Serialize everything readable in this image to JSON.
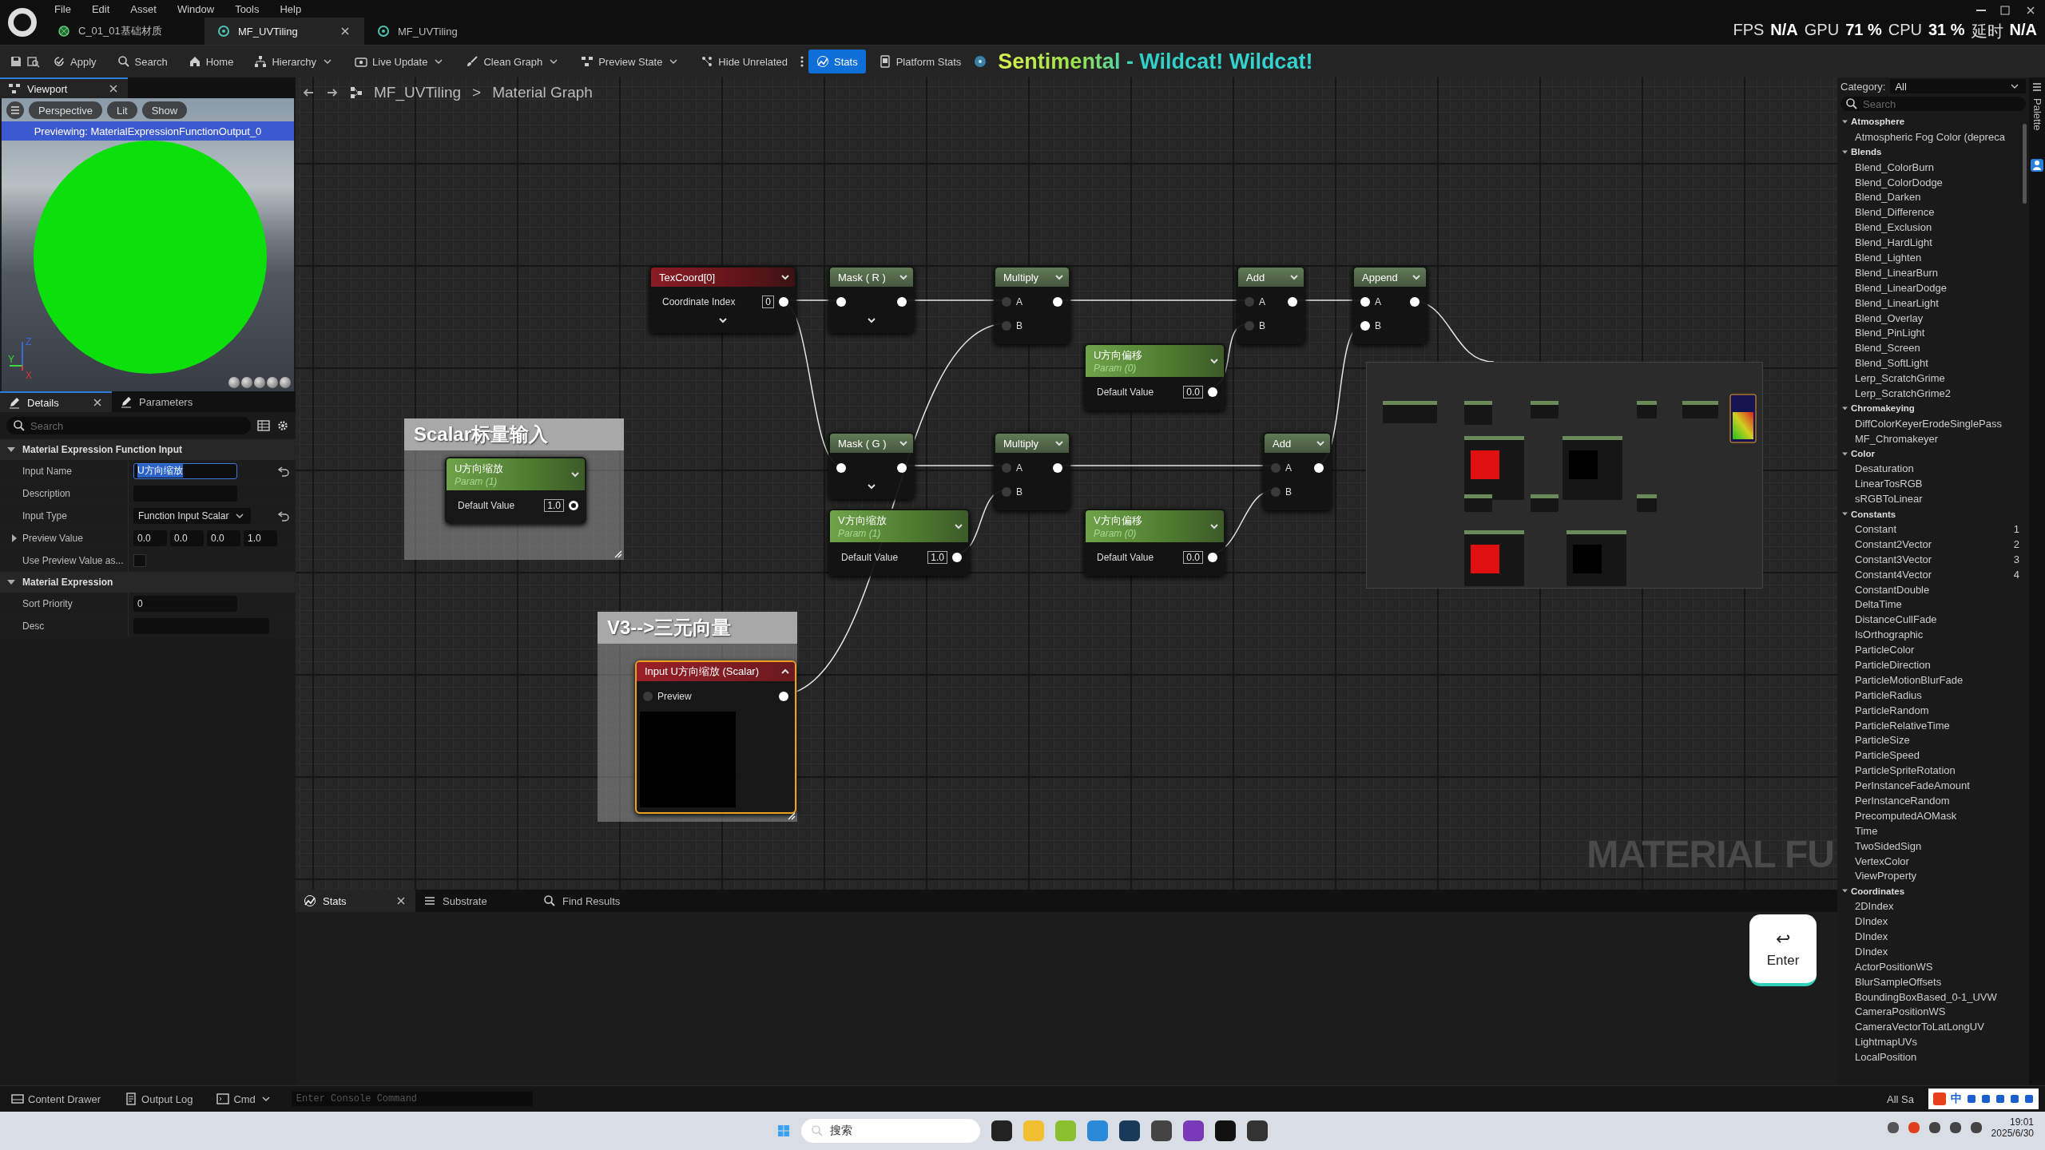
{
  "menu": [
    "File",
    "Edit",
    "Asset",
    "Window",
    "Tools",
    "Help"
  ],
  "document_tabs": [
    {
      "label": "C_01_01基础材质",
      "kind": "material",
      "selected": false,
      "closable": false
    },
    {
      "label": "MF_UVTiling",
      "kind": "function",
      "selected": true,
      "closable": true
    },
    {
      "label": "MF_UVTiling",
      "kind": "function",
      "selected": false,
      "closable": false
    }
  ],
  "perf_stats": [
    {
      "label": "FPS",
      "value": "N/A"
    },
    {
      "label": "GPU",
      "value": "71 %"
    },
    {
      "label": "CPU",
      "value": "31 %"
    },
    {
      "label": "延时",
      "value": "N/A"
    }
  ],
  "toolbar": [
    {
      "label": "Apply",
      "dropdown": false,
      "selected": false
    },
    {
      "label": "Search",
      "dropdown": false,
      "selected": false
    },
    {
      "label": "Home",
      "dropdown": false,
      "selected": false
    },
    {
      "label": "Hierarchy",
      "dropdown": true,
      "selected": false
    },
    {
      "label": "Live Update",
      "dropdown": true,
      "selected": false
    },
    {
      "label": "Clean Graph",
      "dropdown": true,
      "selected": false
    },
    {
      "label": "Preview State",
      "dropdown": true,
      "selected": false
    },
    {
      "label": "Hide Unrelated",
      "dropdown": false,
      "selected": false
    },
    {
      "label": "Stats",
      "dropdown": false,
      "selected": true
    },
    {
      "label": "Platform Stats",
      "dropdown": false,
      "selected": false
    }
  ],
  "now_playing": "Sentimental - Wildcat! Wildcat!",
  "viewport": {
    "tab": "Viewport",
    "buttons": [
      "Perspective",
      "Lit",
      "Show"
    ],
    "banner": "Previewing: MaterialExpressionFunctionOutput_0",
    "axes": [
      "Z",
      "Y",
      "X"
    ]
  },
  "details": {
    "tabs": [
      {
        "label": "Details",
        "selected": true
      },
      {
        "label": "Parameters",
        "selected": false
      }
    ],
    "search_placeholder": "Search",
    "sections": [
      {
        "title": "Material Expression Function Input",
        "expanded": true,
        "rows": [
          {
            "label": "Input Name",
            "kind": "text",
            "value": "U方向缩放",
            "text_selected": true,
            "reset": true
          },
          {
            "label": "Description",
            "kind": "text",
            "text_selected": false,
            "reset": false
          },
          {
            "label": "Input Type",
            "kind": "dropdown",
            "value": "Function Input Scalar",
            "reset": true
          },
          {
            "label": "Preview Value",
            "kind": "vector",
            "values": [
              "0.0",
              "0.0",
              "0.0",
              "1.0"
            ],
            "expanded": false,
            "reset": false
          },
          {
            "label": "Use Preview Value as...",
            "kind": "checkbox",
            "checked": false,
            "reset": false
          }
        ]
      },
      {
        "title": "Material Expression",
        "expanded": true,
        "rows": [
          {
            "label": "Sort Priority",
            "kind": "text",
            "value": "0",
            "text_selected": false,
            "reset": false
          },
          {
            "label": "Desc",
            "kind": "wide",
            "reset": false
          }
        ]
      }
    ]
  },
  "breadcrumb": [
    "MF_UVTiling",
    "Material Graph"
  ],
  "breadcrumb_separator": ">",
  "graph": {
    "nodes": [
      {
        "kind": "function",
        "title": "TexCoord[0]",
        "selected": false,
        "chevron": true,
        "rows": [
          {
            "label": "Coordinate Index",
            "value": "0",
            "out_pin": {
              "filled": true
            }
          }
        ]
      },
      {
        "kind": "math",
        "title": "Mask ( R )",
        "selected": false,
        "chevron": true,
        "rows": [
          {
            "in_pin": {
              "filled": true
            },
            "out_pin": {
              "filled": true
            }
          }
        ]
      },
      {
        "kind": "math",
        "title": "Multiply",
        "selected": false,
        "chevron": false,
        "rows": [
          {
            "label": "A",
            "in_pin": {
              "filled": false
            },
            "out_pin": {
              "filled": true
            }
          },
          {
            "label": "B",
            "in_pin": {
              "filled": false
            }
          }
        ]
      },
      {
        "kind": "math",
        "title": "Add",
        "selected": false,
        "chevron": false,
        "rows": [
          {
            "label": "A",
            "in_pin": {
              "filled": false
            },
            "out_pin": {
              "filled": true
            }
          },
          {
            "label": "B",
            "in_pin": {
              "filled": false
            }
          }
        ]
      },
      {
        "kind": "math",
        "title": "Append",
        "selected": false,
        "chevron": false,
        "rows": [
          {
            "label": "A",
            "in_pin": {
              "filled": true
            },
            "out_pin": {
              "filled": true
            }
          },
          {
            "label": "B",
            "in_pin": {
              "filled": true
            }
          }
        ]
      },
      {
        "kind": "param",
        "title": "U方向偏移",
        "subtitle": "Param (0)",
        "selected": false,
        "chevron": false,
        "rows": [
          {
            "label": "Default Value",
            "value": "0.0",
            "out_pin": {
              "filled": true
            }
          }
        ]
      },
      {
        "kind": "math",
        "title": "Mask ( G )",
        "selected": false,
        "chevron": true,
        "rows": [
          {
            "in_pin": {
              "filled": true
            },
            "out_pin": {
              "filled": true
            }
          }
        ]
      },
      {
        "kind": "math",
        "title": "Multiply",
        "selected": false,
        "chevron": false,
        "rows": [
          {
            "label": "A",
            "in_pin": {
              "filled": false
            },
            "out_pin": {
              "filled": true
            }
          },
          {
            "label": "B",
            "in_pin": {
              "filled": false
            }
          }
        ]
      },
      {
        "kind": "math",
        "title": "Add",
        "selected": false,
        "chevron": false,
        "rows": [
          {
            "label": "A",
            "in_pin": {
              "filled": false
            },
            "out_pin": {
              "filled": true
            }
          },
          {
            "label": "B",
            "in_pin": {
              "filled": false
            }
          }
        ]
      },
      {
        "kind": "param",
        "title": "V方向缩放",
        "subtitle": "Param (1)",
        "selected": false,
        "chevron": false,
        "rows": [
          {
            "label": "Default Value",
            "value": "1.0",
            "out_pin": {
              "filled": true
            }
          }
        ]
      },
      {
        "kind": "param",
        "title": "V方向偏移",
        "subtitle": "Param (0)",
        "selected": false,
        "chevron": false,
        "rows": [
          {
            "label": "Default Value",
            "value": "0.0",
            "out_pin": {
              "filled": true
            }
          }
        ]
      }
    ],
    "comments": [
      {
        "title": "Scalar标量输入",
        "nodes": [
          {
            "kind": "param",
            "title": "U方向缩放",
            "subtitle": "Param (1)",
            "selected": false,
            "chevron": false,
            "rows": [
              {
                "label": "Default Value",
                "value": "1.0",
                "out_pin": {
                  "filled": false
                }
              }
            ]
          }
        ]
      },
      {
        "title": "V3-->三元向量",
        "nodes": [
          {
            "kind": "input",
            "title": "Input U方向缩放 (Scalar)",
            "selected": true,
            "chevron": false,
            "preview": true,
            "rows": [
              {
                "label": "Preview",
                "in_pin": {
                  "filled": false
                },
                "out_pin": {
                  "filled": true
                }
              }
            ]
          }
        ]
      }
    ],
    "watermark": "MATERIAL FU"
  },
  "bottom_tabs": [
    {
      "label": "Stats",
      "selected": true,
      "closable": true
    },
    {
      "label": "Substrate",
      "selected": false,
      "closable": false
    },
    {
      "label": "Find Results",
      "selected": false,
      "closable": false
    }
  ],
  "palette": {
    "category_label": "Category:",
    "category": "All",
    "search_placeholder": "Search",
    "side_tab": "Palette",
    "groups": [
      {
        "title": "Atmosphere",
        "expanded": true,
        "children": [
          {
            "label": "Atmospheric Fog Color (depreca"
          }
        ]
      },
      {
        "title": "Blends",
        "expanded": true,
        "children": [
          {
            "label": "Blend_ColorBurn"
          },
          {
            "label": "Blend_ColorDodge"
          },
          {
            "label": "Blend_Darken"
          },
          {
            "label": "Blend_Difference"
          },
          {
            "label": "Blend_Exclusion"
          },
          {
            "label": "Blend_HardLight"
          },
          {
            "label": "Blend_Lighten"
          },
          {
            "label": "Blend_LinearBurn"
          },
          {
            "label": "Blend_LinearDodge"
          },
          {
            "label": "Blend_LinearLight"
          },
          {
            "label": "Blend_Overlay"
          },
          {
            "label": "Blend_PinLight"
          },
          {
            "label": "Blend_Screen"
          },
          {
            "label": "Blend_SoftLight"
          },
          {
            "label": "Lerp_ScratchGrime"
          },
          {
            "label": "Lerp_ScratchGrime2"
          }
        ]
      },
      {
        "title": "Chromakeying",
        "expanded": true,
        "children": [
          {
            "label": "DiffColorKeyerErodeSinglePass"
          },
          {
            "label": "MF_Chromakeyer"
          }
        ]
      },
      {
        "title": "Color",
        "expanded": true,
        "children": [
          {
            "label": "Desaturation"
          },
          {
            "label": "LinearTosRGB"
          },
          {
            "label": "sRGBToLinear"
          }
        ]
      },
      {
        "title": "Constants",
        "expanded": true,
        "children": [
          {
            "label": "Constant",
            "hotkey": "1"
          },
          {
            "label": "Constant2Vector",
            "hotkey": "2"
          },
          {
            "label": "Constant3Vector",
            "hotkey": "3"
          },
          {
            "label": "Constant4Vector",
            "hotkey": "4"
          },
          {
            "label": "ConstantDouble"
          },
          {
            "label": "DeltaTime"
          },
          {
            "label": "DistanceCullFade"
          },
          {
            "label": "IsOrthographic"
          },
          {
            "label": "ParticleColor"
          },
          {
            "label": "ParticleDirection"
          },
          {
            "label": "ParticleMotionBlurFade"
          },
          {
            "label": "ParticleRadius"
          },
          {
            "label": "ParticleRandom"
          },
          {
            "label": "ParticleRelativeTime"
          },
          {
            "label": "ParticleSize"
          },
          {
            "label": "ParticleSpeed"
          },
          {
            "label": "ParticleSpriteRotation"
          },
          {
            "label": "PerInstanceFadeAmount"
          },
          {
            "label": "PerInstanceRandom"
          },
          {
            "label": "PrecomputedAOMask"
          },
          {
            "label": "Time"
          },
          {
            "label": "TwoSidedSign"
          },
          {
            "label": "VertexColor"
          },
          {
            "label": "ViewProperty"
          }
        ]
      },
      {
        "title": "Coordinates",
        "expanded": true,
        "children": [
          {
            "label": "2DIndex"
          },
          {
            "label": "DIndex"
          },
          {
            "label": "DIndex"
          },
          {
            "label": "DIndex"
          },
          {
            "label": "ActorPositionWS"
          },
          {
            "label": "BlurSampleOffsets"
          },
          {
            "label": "BoundingBoxBased_0-1_UVW"
          },
          {
            "label": "CameraPositionWS"
          },
          {
            "label": "CameraVectorToLatLongUV"
          },
          {
            "label": "LightmapUVs"
          },
          {
            "label": "LocalPosition"
          }
        ]
      }
    ]
  },
  "key_overlay": {
    "symbol": "↩",
    "label": "Enter"
  },
  "status_bar": {
    "items": [
      {
        "label": "Content Drawer"
      },
      {
        "label": "Output Log"
      },
      {
        "label": "Cmd"
      }
    ],
    "console_placeholder": "Enter Console Command",
    "right": "All Sa",
    "ime": "中"
  },
  "taskbar": {
    "search_placeholder": "搜索",
    "time": "19:01",
    "date": "2025/6/30"
  }
}
